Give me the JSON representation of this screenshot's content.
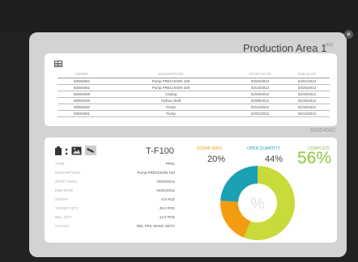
{
  "window": {
    "title": "Production Area 1",
    "subtitle": "(2/0)",
    "close_label": "×"
  },
  "orders": {
    "columns": [
      "ORDER",
      "DESCRIPTION",
      "START DATE",
      "END DATE"
    ],
    "rows": [
      [
        "60004562",
        "Pump PRECISION 100",
        "03/20/2012",
        "04/01/2012"
      ],
      [
        "60004561",
        "Pump PRECISION 100",
        "03/13/2012",
        "03/25/2012"
      ],
      [
        "60004508",
        "Casing",
        "02/09/2012",
        "02/15/2012"
      ],
      [
        "60004549",
        "Hollow shaft",
        "02/08/2012",
        "02/15/2012"
      ],
      [
        "60004500",
        "Pump",
        "02/12/2012",
        "02/15/2012"
      ],
      [
        "60004501",
        "Pump",
        "02/01/2012",
        "02/12/2012"
      ]
    ],
    "selected_order": "60004562"
  },
  "detail": {
    "title": "T-F100",
    "properties": [
      {
        "label": "TYPE",
        "value": "PP01"
      },
      {
        "label": "DESCRIPTION",
        "value": "Pump PRECISION 100"
      },
      {
        "label": "START DATE",
        "value": "03/20/2012"
      },
      {
        "label": "END DATE",
        "value": "04/01/2012"
      },
      {
        "label": "SCRAP",
        "value": "6.0 PCE"
      },
      {
        "label": "TARGET QTY",
        "value": "25.0 PCE"
      },
      {
        "label": "DEL. QTY",
        "value": "14.0 PCE"
      },
      {
        "label": "STATUS",
        "value": "REL PRC MANC SETC"
      }
    ]
  },
  "kpis": {
    "scrap_rate": {
      "label": "SCRAP RATE",
      "value": "20%",
      "color": "#f39c12"
    },
    "open_quantity": {
      "label": "OPEN QUANTITY",
      "value": "44%",
      "color": "#1ba1b3"
    },
    "complete": {
      "label": "COMPLETE",
      "value": "56%",
      "color": "#8cc63f"
    }
  },
  "donut": {
    "center_label": "%",
    "segments": [
      {
        "name": "complete",
        "value": 56,
        "color": "#c9da3b"
      },
      {
        "name": "scrap",
        "value": 20,
        "color": "#f39c12"
      },
      {
        "name": "open",
        "value": 24,
        "color": "#1ba1b3"
      }
    ]
  }
}
